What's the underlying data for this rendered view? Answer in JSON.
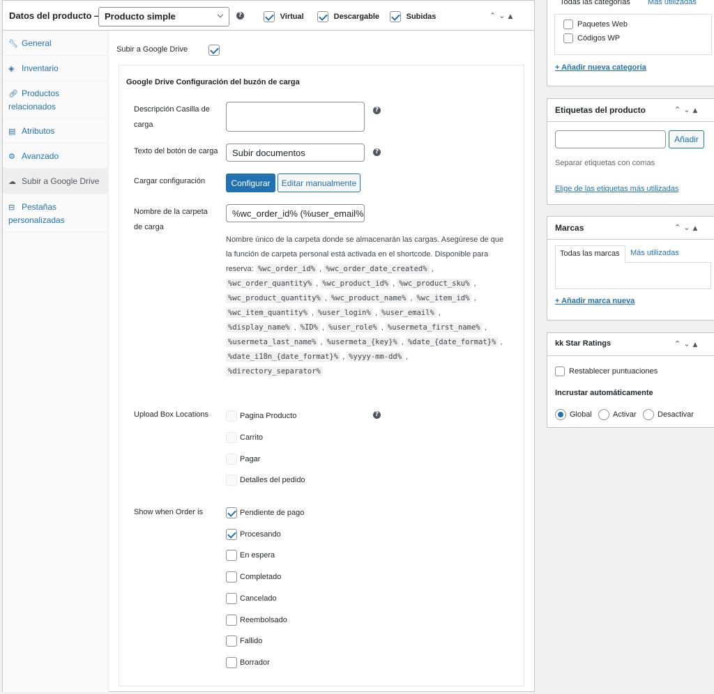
{
  "header": {
    "title": "Datos del producto —",
    "product_type": "Producto simple",
    "virtual_label": "Virtual",
    "descargable_label": "Descargable",
    "subidas_label": "Subidas"
  },
  "tabs": [
    {
      "label": "General",
      "icon": "wrench-icon"
    },
    {
      "label": "Inventario",
      "icon": "tag-icon"
    },
    {
      "label": "Productos relacionados",
      "icon": "link-icon"
    },
    {
      "label": "Atributos",
      "icon": "table-icon"
    },
    {
      "label": "Avanzado",
      "icon": "gear-icon"
    },
    {
      "label": "Subir a Google Drive",
      "icon": "cloud-icon"
    },
    {
      "label": "Pestañas personalizadas",
      "icon": "tabs-icon"
    }
  ],
  "panel": {
    "upload_toggle_label": "Subir a Google Drive",
    "box_title": "Google Drive Configuración del buzón de carga",
    "desc_label": "Descripción Casilla de carga",
    "desc_value": "",
    "button_text_label": "Texto del botón de carga",
    "button_text_value": "Subir documentos",
    "config_label": "Cargar configuración",
    "configure_btn": "Configurar",
    "edit_btn": "Editar manualmente",
    "folder_label": "Nombre de la carpeta de carga",
    "folder_value": "%wc_order_id% (%user_email%)/%",
    "folder_desc_intro": "Nombre único de la carpeta donde se almacenarán las cargas. Asegúrese de que la función de carpeta personal está activada en el shortcode. Disponible para reserva:",
    "placeholders": [
      "%wc_order_id%",
      "%wc_order_date_created%",
      "%wc_order_quantity%",
      "%wc_product_id%",
      "%wc_product_sku%",
      "%wc_product_quantity%",
      "%wc_product_name%",
      "%wc_item_id%",
      "%wc_item_quantity%",
      "%user_login%",
      "%user_email%",
      "%display_name%",
      "%ID%",
      "%user_role%",
      "%usermeta_first_name%",
      "%usermeta_last_name%",
      "%usermeta_{key}%",
      "%date_{date_format}%",
      "%date_i18n_{date_format}%",
      "%yyyy-mm-dd%",
      "%directory_separator%"
    ],
    "locations_label": "Upload Box Locations",
    "locations": [
      "Pagina Producto",
      "Carrito",
      "Pagar",
      "Detalles del pedido"
    ],
    "order_label": "Show when Order is",
    "order_statuses": [
      {
        "label": "Pendiente de pago",
        "checked": true
      },
      {
        "label": "Procesando",
        "checked": true
      },
      {
        "label": "En espera",
        "checked": false
      },
      {
        "label": "Completado",
        "checked": false
      },
      {
        "label": "Cancelado",
        "checked": false
      },
      {
        "label": "Reembolsado",
        "checked": false
      },
      {
        "label": "Fallido",
        "checked": false
      },
      {
        "label": "Borrador",
        "checked": false
      }
    ]
  },
  "categories": {
    "tab_all": "Todas las categorías",
    "tab_most": "Más utilizadas",
    "items": [
      "Paquetes Web",
      "Códigos WP"
    ],
    "add_link": "+ Añadir nueva categoría"
  },
  "tags": {
    "title": "Etiquetas del producto",
    "add_btn": "Añadir",
    "hint": "Separar etiquetas con comas",
    "choose_link": "Elige de las etiquetas más utilizadas"
  },
  "brands": {
    "title": "Marcas",
    "tab_all": "Todas las marcas",
    "tab_most": "Más utilizadas",
    "add_link": "+ Añadir marca nueva"
  },
  "stars": {
    "title": "kk Star Ratings",
    "reset_label": "Restablecer puntuaciones",
    "embed_label": "Incrustar automáticamente",
    "options": [
      "Global",
      "Activar",
      "Desactivar"
    ]
  }
}
